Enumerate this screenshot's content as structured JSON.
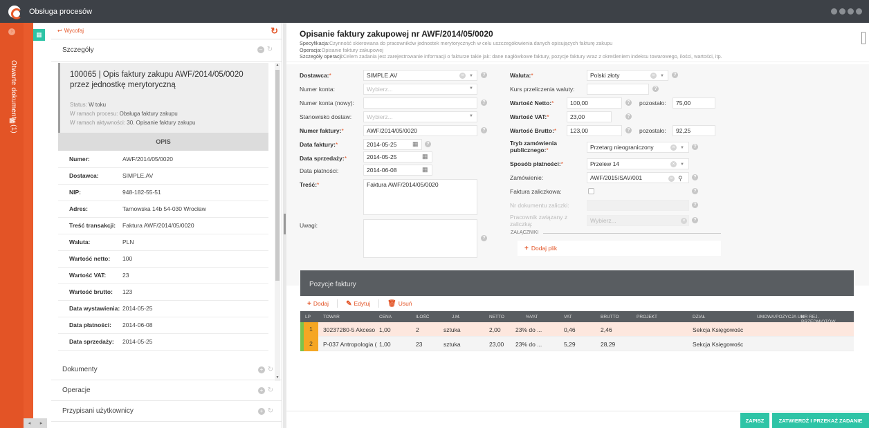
{
  "app": {
    "title": "Obsługa procesów"
  },
  "sidebar": {
    "open_documents": "Otwarte dokumenty (1)"
  },
  "left_panel": {
    "back_label": "Wycofaj",
    "details_heading": "Szczegóły",
    "card_title": "100065 | Opis faktury zakupu AWF/2014/05/0020 przez jednostkę merytoryczną",
    "status_label": "Status:",
    "status_value": "W toku",
    "process_label": "W ramach procesu:",
    "process_value": "Obsługa faktury zakupu",
    "activity_label": "W ramach aktywności:",
    "activity_value": "30. Opisanie faktury zakupu",
    "opis_label": "OPIS",
    "fields": [
      {
        "k": "Numer:",
        "v": "AWF/2014/05/0020"
      },
      {
        "k": "Dostawca:",
        "v": "SIMPLE.AV"
      },
      {
        "k": "NIP:",
        "v": "948-182-55-51"
      },
      {
        "k": "Adres:",
        "v": "Tarnowska 14b 54-030 Wrocław"
      },
      {
        "k": "Treść transakcji:",
        "v": "Faktura AWF/2014/05/0020"
      },
      {
        "k": "Waluta:",
        "v": "PLN"
      },
      {
        "k": "Wartość netto:",
        "v": "100"
      },
      {
        "k": "Wartość VAT:",
        "v": "23"
      },
      {
        "k": "Wartość brutto:",
        "v": "123"
      },
      {
        "k": "Data wystawienia:",
        "v": "2014-05-25"
      },
      {
        "k": "Data płatności:",
        "v": "2014-06-08"
      },
      {
        "k": "Data sprzedaży:",
        "v": "2014-05-25"
      }
    ],
    "sections": [
      "Dokumenty",
      "Operacje",
      "Przypisani użytkownicy"
    ]
  },
  "header": {
    "title": "Opisanie faktury zakupowej nr AWF/2014/05/0020",
    "spec_label": "Specyfikacja:",
    "spec_value": "Czynność skierowana do pracowników jednostek merytorycznych w celu uszczegółowienia danych opisujących fakturę zakupu",
    "op_label": "Operacja:",
    "op_value": "Opisanie faktury zakupowej",
    "det_label": "Szczegóły operacji:",
    "det_value": "Celem zadania jest zarejestrowanie informacji o fakturze takie jak: dane nagłówkowe faktury, pozycje faktury wraz z określeniem indeksu towarowego, ilości, wartości, itp."
  },
  "form": {
    "dostawca_label": "Dostawca:",
    "dostawca_value": "SIMPLE.AV",
    "numer_konta_label": "Numer konta:",
    "numer_konta_placeholder": "Wybierz...",
    "numer_konta_nowy_label": "Numer konta (nowy):",
    "stanowisko_label": "Stanowisko dostaw:",
    "stanowisko_placeholder": "Wybierz...",
    "numer_faktury_label": "Numer faktury:",
    "numer_faktury_value": "AWF/2014/05/0020",
    "data_faktury_label": "Data faktury:",
    "data_faktury_value": "2014-05-25",
    "data_sprzedazy_label": "Data sprzedaży:",
    "data_sprzedazy_value": "2014-05-25",
    "data_platnosci_label": "Data płatności:",
    "data_platnosci_value": "2014-06-08",
    "tresc_label": "Treść:",
    "tresc_value": "Faktura AWF/2014/05/0020",
    "uwagi_label": "Uwagi:",
    "waluta_label": "Waluta:",
    "waluta_value": "Polski złoty",
    "kurs_label": "Kurs przeliczenia waluty:",
    "netto_label": "Wartość Netto:",
    "netto_value": "100,00",
    "pozostalo_label": "pozostało:",
    "netto_pozostalo": "75,00",
    "vat_label": "Wartość VAT:",
    "vat_value": "23,00",
    "brutto_label": "Wartość Brutto:",
    "brutto_value": "123,00",
    "brutto_pozostalo": "92,25",
    "tryb_label": "Tryb zamówienia publicznego:",
    "tryb_value": "Przetarg nieograniczony",
    "sposob_label": "Sposób płatności:",
    "sposob_value": "Przelew 14",
    "zamowienie_label": "Zamówienie:",
    "zamowienie_value": "AWF/2015/SAV/001",
    "zaliczkowa_label": "Faktura zaliczkowa:",
    "nr_zaliczki_label": "Nr dokumentu zaliczki:",
    "pracownik_label": "Pracownik związany z zaliczką:",
    "pracownik_placeholder": "Wybierz...",
    "zalaczniki_label": "ZAŁĄCZNIKI",
    "dodaj_plik": "Dodaj plik"
  },
  "items": {
    "heading": "Pozycje faktury",
    "toolbar": {
      "add": "Dodaj",
      "edit": "Edytuj",
      "delete": "Usuń"
    },
    "columns": [
      "LP",
      "TOWAR",
      "CENA",
      "ILOŚĆ",
      "J.M.",
      "NETTO",
      "%VAT",
      "VAT",
      "BRUTTO",
      "PROJEKT",
      "DZIAŁ",
      "UMOWA/POZYCJA UM",
      "NR REJ. PRZEDMIOTÓW"
    ],
    "rows": [
      {
        "lp": "1",
        "towar": "30237280-5 Akceso",
        "cena": "1,00",
        "ilosc": "2",
        "jm": "sztuka",
        "netto": "2,00",
        "vat_pct": "23% do ...",
        "vat": "0,46",
        "brutto": "2,46",
        "dzial": "Sekcja Księgowośc"
      },
      {
        "lp": "2",
        "towar": "P-037 Antropologia (",
        "cena": "1,00",
        "ilosc": "23",
        "jm": "sztuka",
        "netto": "23,00",
        "vat_pct": "23% do ...",
        "vat": "5,29",
        "brutto": "28,29",
        "dzial": "Sekcja Księgowośc"
      }
    ]
  },
  "footer": {
    "save": "ZAPISZ",
    "approve": "ZATWIERDŹ I PRZEKAŻ ZADANIE"
  },
  "colors": {
    "accent": "#e35426",
    "teal": "#2ec4a6",
    "dark": "#3d4147"
  }
}
